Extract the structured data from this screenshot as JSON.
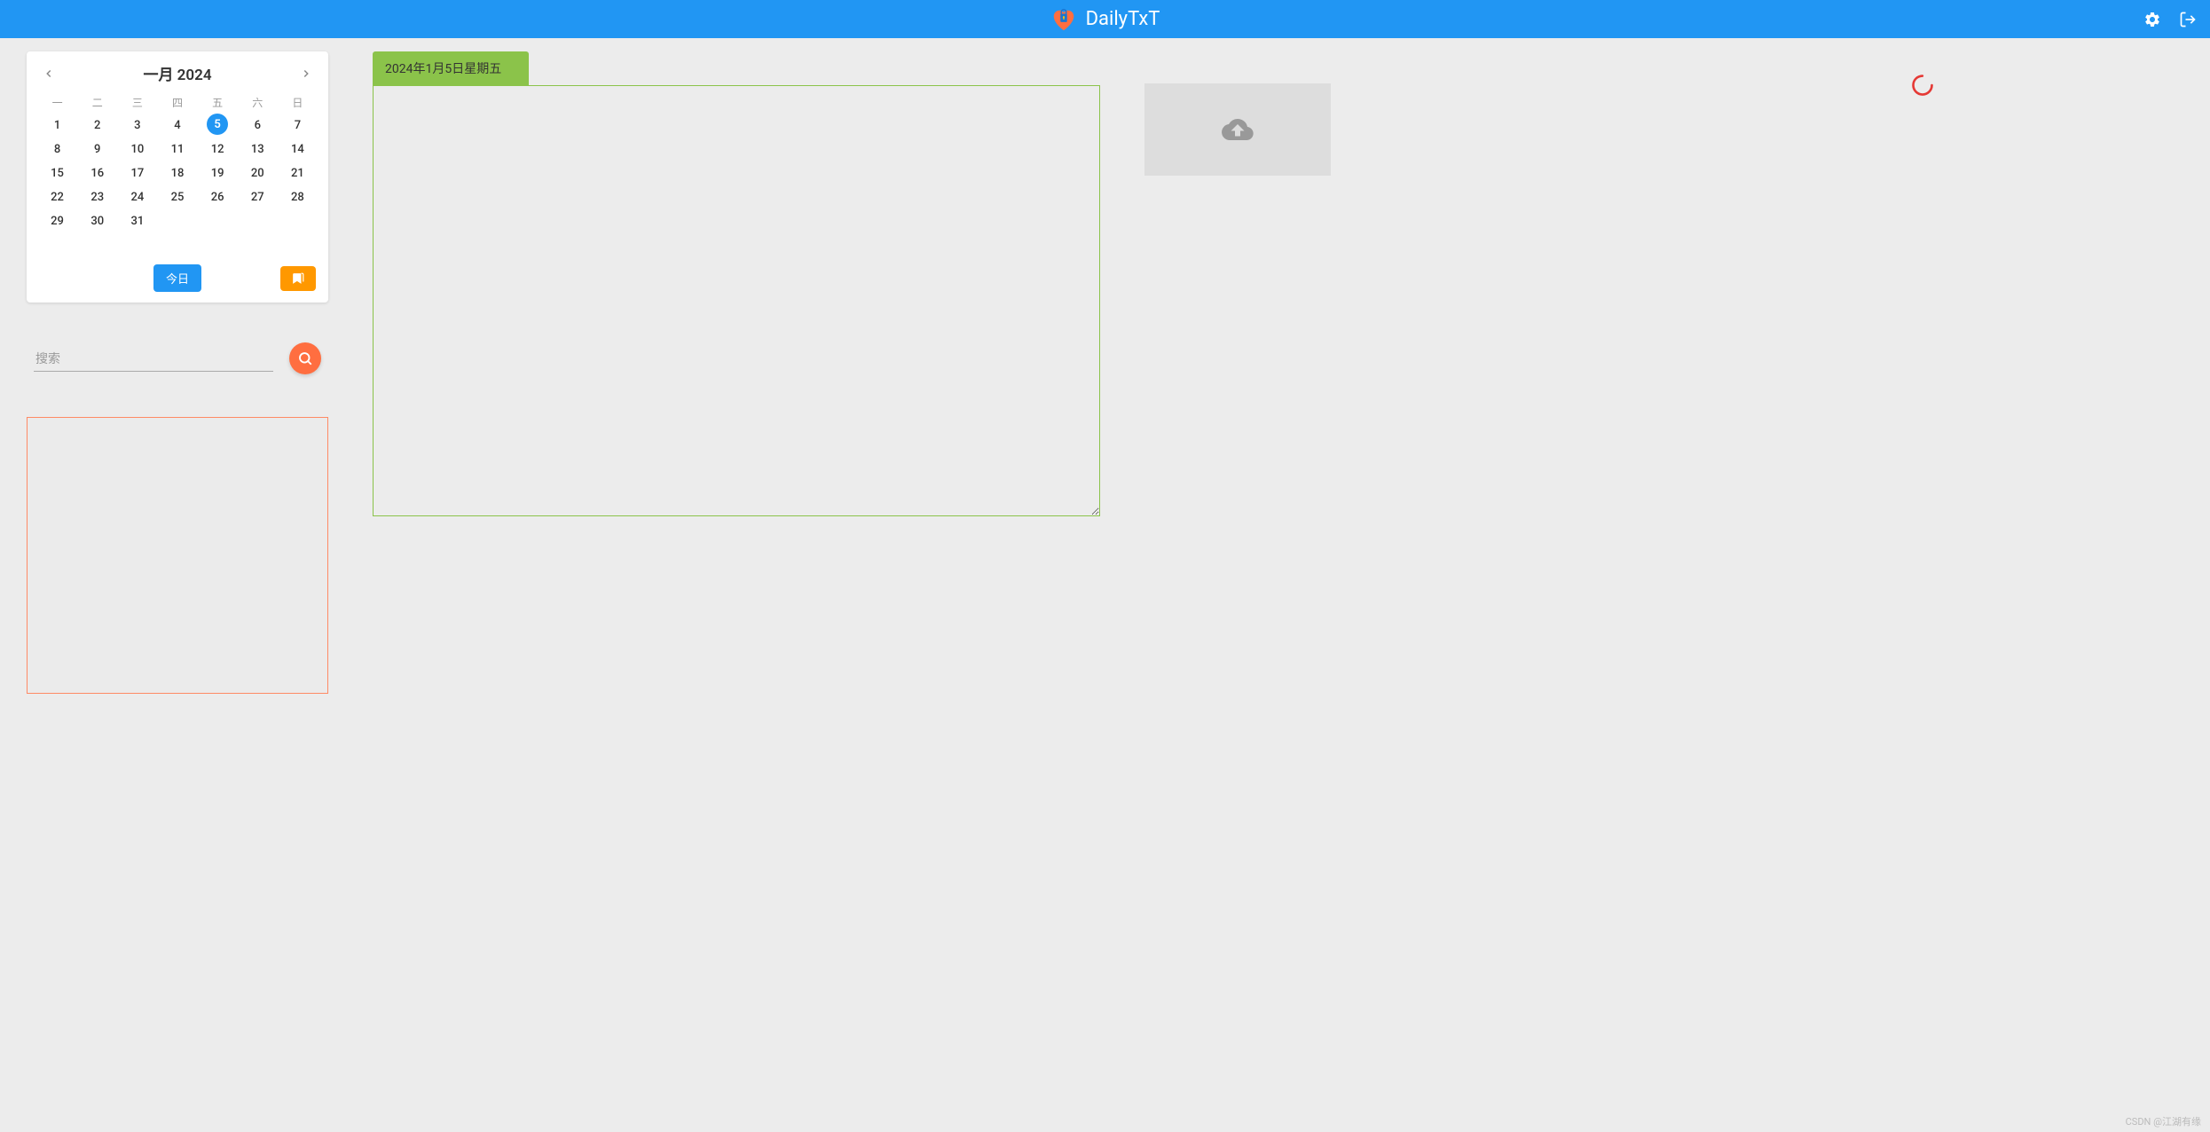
{
  "app": {
    "title": "DailyTxT"
  },
  "calendar": {
    "month_label": "一月 2024",
    "weekdays": [
      "一",
      "二",
      "三",
      "四",
      "五",
      "六",
      "日"
    ],
    "days": [
      [
        1,
        2,
        3,
        4,
        5,
        6,
        7
      ],
      [
        8,
        9,
        10,
        11,
        12,
        13,
        14
      ],
      [
        15,
        16,
        17,
        18,
        19,
        20,
        21
      ],
      [
        22,
        23,
        24,
        25,
        26,
        27,
        28
      ],
      [
        29,
        30,
        31
      ]
    ],
    "selected_day": 5,
    "today_label": "今日"
  },
  "search": {
    "placeholder": "搜索"
  },
  "entry": {
    "date_label": "2024年1月5日星期五",
    "text": ""
  },
  "watermark": "CSDN @江湖有缘"
}
